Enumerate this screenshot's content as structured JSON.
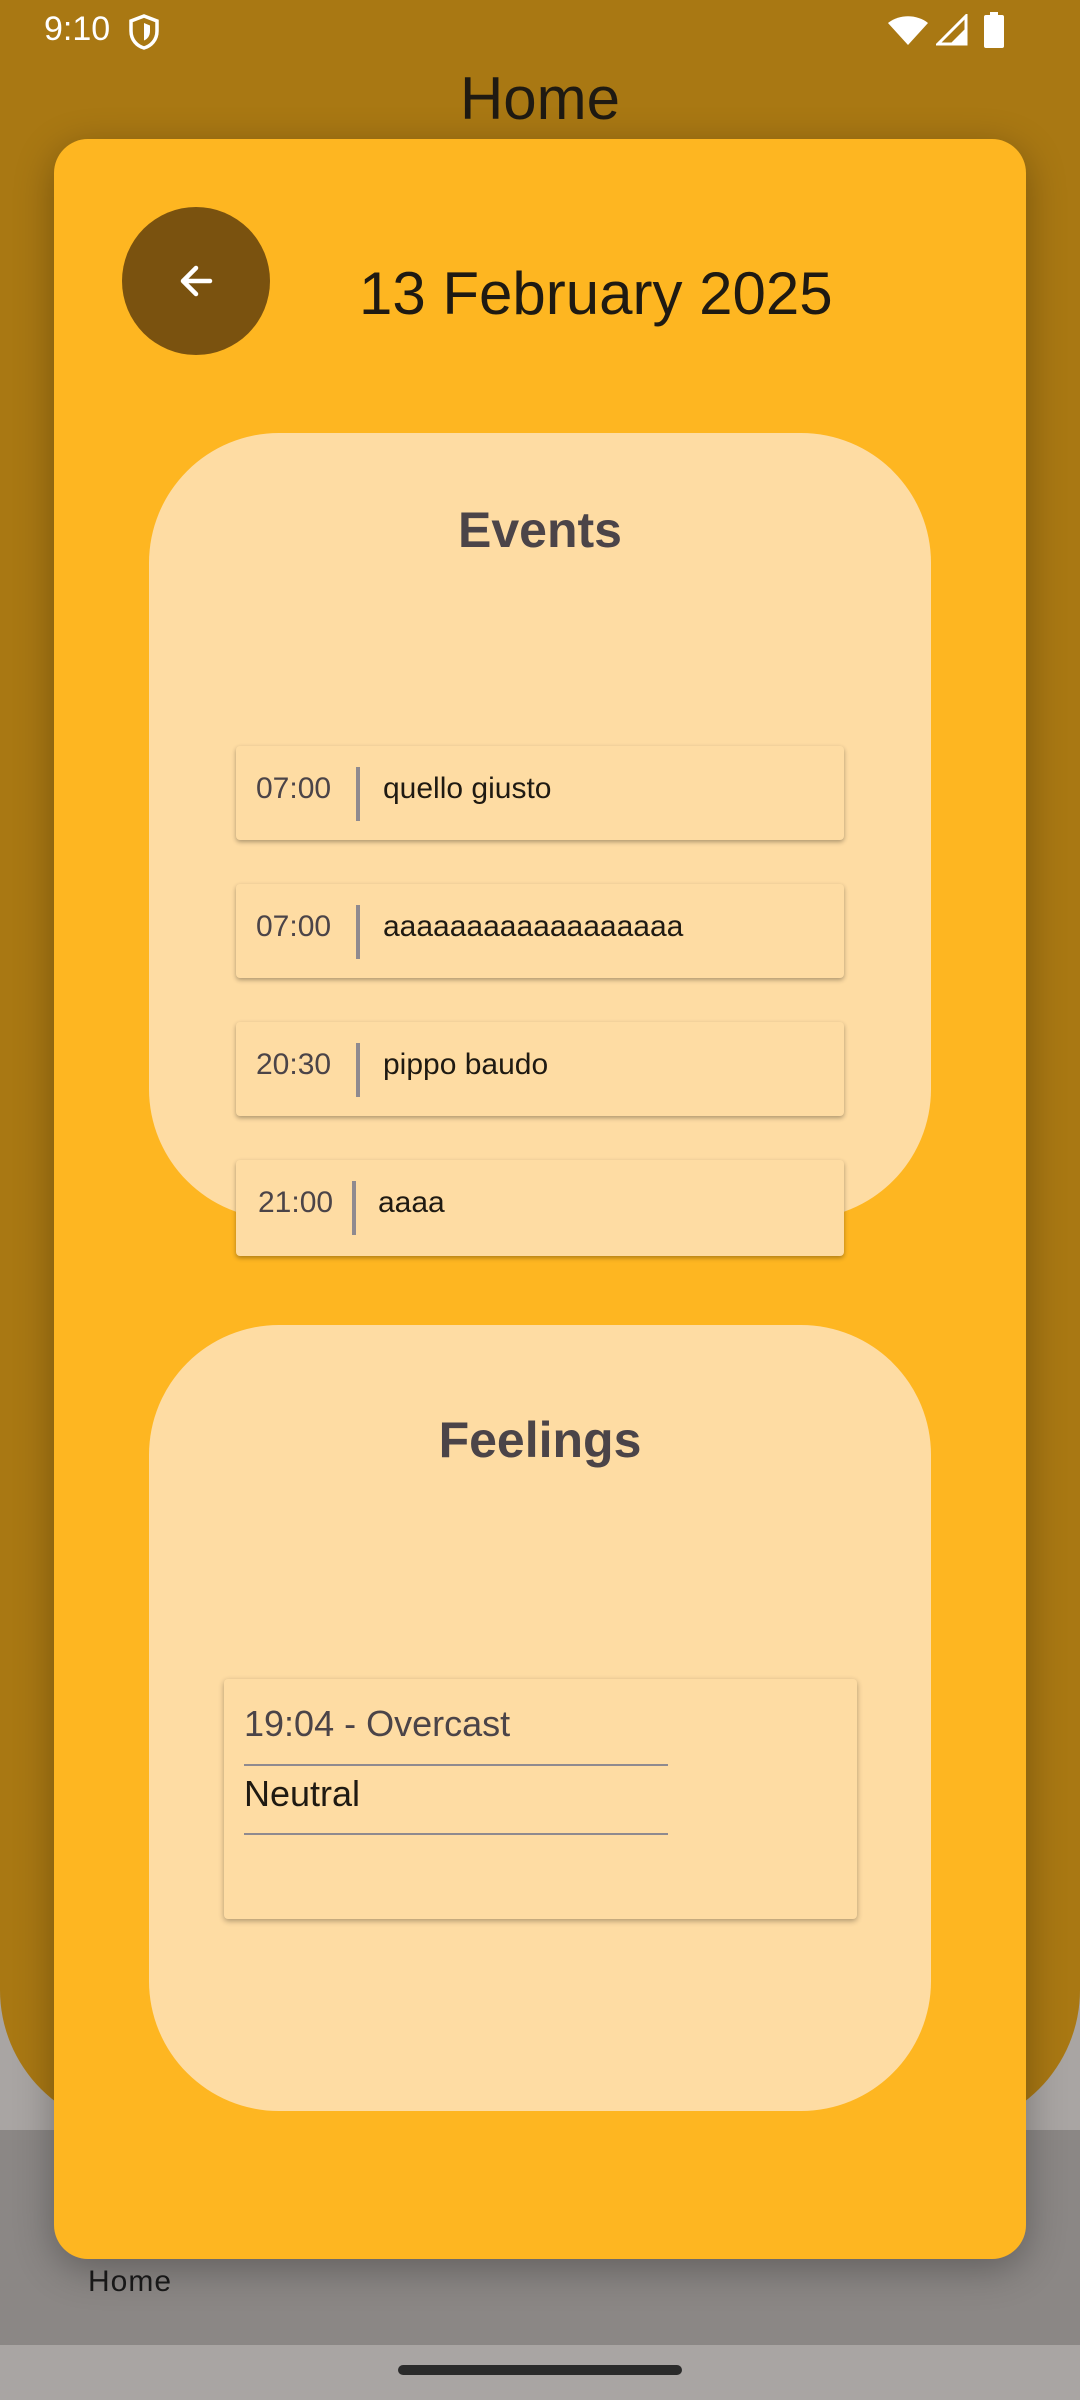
{
  "status_bar": {
    "time": "9:10"
  },
  "app": {
    "title": "Home"
  },
  "bottom_nav": {
    "label": "Home"
  },
  "dialog": {
    "date": "13 February 2025",
    "events": {
      "title": "Events",
      "items": [
        {
          "time": "07:00",
          "name": "quello giusto"
        },
        {
          "time": "07:00",
          "name": "aaaaaaaaaaaaaaaaaa"
        },
        {
          "time": "20:30",
          "name": "pippo baudo"
        },
        {
          "time": "21:00",
          "name": "aaaa"
        }
      ]
    },
    "feelings": {
      "title": "Feelings",
      "entries": [
        {
          "time_weather": "19:04 - Overcast",
          "mood": "Neutral"
        }
      ]
    }
  },
  "colors": {
    "background_accent": "#a97813",
    "dialog": "#feb621",
    "card": "#fedca3",
    "back_button": "#7a520f"
  },
  "icons": [
    "shield-icon",
    "wifi-icon",
    "signal-icon",
    "battery-icon",
    "arrow-back-icon"
  ]
}
